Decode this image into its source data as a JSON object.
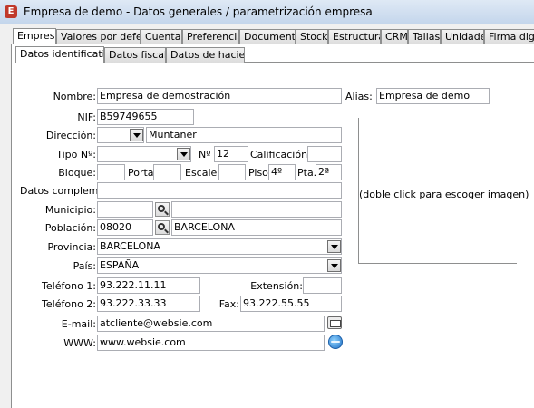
{
  "window": {
    "title": "Empresa de demo - Datos generales / parametrización empresa",
    "app_icon_letter": "E"
  },
  "main_tabs": [
    {
      "label": "Empresa"
    },
    {
      "label": "Valores por defecto"
    },
    {
      "label": "Cuentas"
    },
    {
      "label": "Preferencias"
    },
    {
      "label": "Documentos"
    },
    {
      "label": "Stock"
    },
    {
      "label": "Estructuras"
    },
    {
      "label": "CRM"
    },
    {
      "label": "Tallas"
    },
    {
      "label": "Unidades"
    },
    {
      "label": "Firma digital"
    }
  ],
  "sub_tabs": [
    {
      "label": "Datos identificativos"
    },
    {
      "label": "Datos fiscales"
    },
    {
      "label": "Datos de hacienda"
    }
  ],
  "form": {
    "nombre": {
      "label": "Nombre:",
      "value": "Empresa de demostración"
    },
    "alias": {
      "label": "Alias:",
      "value": "Empresa de demo"
    },
    "nif": {
      "label": "NIF:",
      "value": "B59749655"
    },
    "direccion": {
      "label": "Dirección:",
      "type_value": "",
      "value": "Muntaner"
    },
    "tipo_no": {
      "label": "Tipo Nº:",
      "value": ""
    },
    "numero": {
      "label": "Nº",
      "value": "12"
    },
    "calificacion": {
      "label": "Calificación:",
      "value": ""
    },
    "bloque": {
      "label": "Bloque:",
      "value": ""
    },
    "portal": {
      "label": "Portal",
      "value": ""
    },
    "escalera": {
      "label": "Escalera",
      "value": ""
    },
    "piso": {
      "label": "Piso",
      "value": "4º"
    },
    "pta": {
      "label": "Pta.",
      "value": "2ª"
    },
    "datos_complement": {
      "label": "Datos complement.:",
      "value": ""
    },
    "municipio": {
      "label": "Municipio:",
      "code": "",
      "name": ""
    },
    "poblacion": {
      "label": "Población:",
      "code": "08020",
      "name": "BARCELONA"
    },
    "provincia": {
      "label": "Provincia:",
      "value": "BARCELONA"
    },
    "pais": {
      "label": "País:",
      "value": "ESPAÑA"
    },
    "telefono1": {
      "label": "Teléfono 1:",
      "value": "93.222.11.11"
    },
    "extension": {
      "label": "Extensión:",
      "value": ""
    },
    "telefono2": {
      "label": "Teléfono 2:",
      "value": "93.222.33.33"
    },
    "fax": {
      "label": "Fax:",
      "value": "93.222.55.55"
    },
    "email": {
      "label": "E-mail:",
      "value": "atcliente@websie.com"
    },
    "www": {
      "label": "WWW:",
      "value": "www.websie.com"
    }
  },
  "image_hint": "(doble click para escoger imagen)"
}
